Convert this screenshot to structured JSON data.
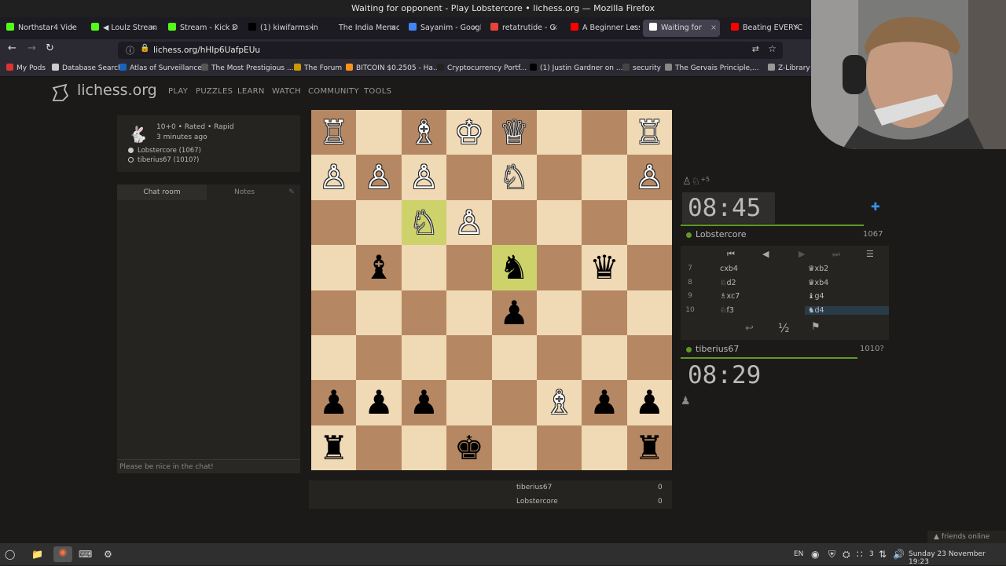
{
  "window": {
    "title": "Waiting for opponent - Play Lobstercore • lichess.org — Mozilla Firefox"
  },
  "tabs": [
    {
      "label": "Northstar4 Vide",
      "color": "#53fc18"
    },
    {
      "label": "◀ Loulz Strean",
      "color": "#53fc18"
    },
    {
      "label": "Stream - Kick D",
      "color": "#53fc18"
    },
    {
      "label": "(1) kiwifarms in",
      "color": "#000000"
    },
    {
      "label": "The India Menace |",
      "color": ""
    },
    {
      "label": "Sayanim - Googl",
      "color": "#4285f4"
    },
    {
      "label": "retatrutide - G",
      "color": "#ea4335"
    },
    {
      "label": "A Beginner Less",
      "color": "#ff0000"
    },
    {
      "label": "Waiting for",
      "color": "#ffffff"
    },
    {
      "label": "Beating EVERYC",
      "color": "#ff0000"
    }
  ],
  "nav": {
    "url": "lichess.org/hHlp6UafpEUu"
  },
  "bookmarks": [
    {
      "label": "My Pods",
      "color": "#d33"
    },
    {
      "label": "Database Search",
      "color": "#ccc"
    },
    {
      "label": "Atlas of Surveillance",
      "color": "#1565c0"
    },
    {
      "label": "The Most Prestigious ...",
      "color": "#555"
    },
    {
      "label": "The Forum",
      "color": "#c90"
    },
    {
      "label": "BITCOIN $0.2505 - Ha...",
      "color": "#f7931a"
    },
    {
      "label": "Cryptocurrency Portf...",
      "color": "#222"
    },
    {
      "label": "(1) Justin Gardner on ...",
      "color": "#000"
    },
    {
      "label": "security",
      "color": "#444"
    },
    {
      "label": "The Gervais Principle,...",
      "color": "#888"
    },
    {
      "label": "Z-Library - the",
      "color": "#999"
    }
  ],
  "site": {
    "logo": "lichess.org",
    "nav": [
      "PLAY",
      "PUZZLES",
      "LEARN",
      "WATCH",
      "COMMUNITY",
      "TOOLS"
    ]
  },
  "game": {
    "setup": "10+0 • Rated • Rapid",
    "time_ago": "3 minutes ago",
    "white_player": "Lobstercore (1067)",
    "black_player": "tiberius67 (1010?)"
  },
  "chat": {
    "tab_chat": "Chat room",
    "tab_notes": "Notes",
    "placeholder": "Please be nice in the chat!"
  },
  "board": {
    "orientation": "black",
    "light": "#f0d9b5",
    "dark": "#b58863",
    "last_move_color": "#ced26b",
    "last_move_squares": [
      "d4",
      "f3"
    ],
    "pieces": [
      {
        "sq": "h1",
        "p": "R",
        "c": "w"
      },
      {
        "sq": "f1",
        "p": "B",
        "c": "w"
      },
      {
        "sq": "e1",
        "p": "K",
        "c": "w"
      },
      {
        "sq": "d1",
        "p": "Q",
        "c": "w"
      },
      {
        "sq": "a1",
        "p": "R",
        "c": "w"
      },
      {
        "sq": "h2",
        "p": "P",
        "c": "w"
      },
      {
        "sq": "g2",
        "p": "P",
        "c": "w"
      },
      {
        "sq": "f2",
        "p": "P",
        "c": "w"
      },
      {
        "sq": "d2",
        "p": "N",
        "c": "w"
      },
      {
        "sq": "a2",
        "p": "P",
        "c": "w"
      },
      {
        "sq": "f3",
        "p": "N",
        "c": "w"
      },
      {
        "sq": "e3",
        "p": "P",
        "c": "w"
      },
      {
        "sq": "g4",
        "p": "B",
        "c": "b"
      },
      {
        "sq": "d4",
        "p": "N",
        "c": "b"
      },
      {
        "sq": "b4",
        "p": "Q",
        "c": "b"
      },
      {
        "sq": "d5",
        "p": "P",
        "c": "b"
      },
      {
        "sq": "h7",
        "p": "P",
        "c": "b"
      },
      {
        "sq": "g7",
        "p": "P",
        "c": "b"
      },
      {
        "sq": "f7",
        "p": "P",
        "c": "b"
      },
      {
        "sq": "c7",
        "p": "B",
        "c": "w"
      },
      {
        "sq": "b7",
        "p": "P",
        "c": "b"
      },
      {
        "sq": "a7",
        "p": "P",
        "c": "b"
      },
      {
        "sq": "h8",
        "p": "R",
        "c": "b"
      },
      {
        "sq": "e8",
        "p": "K",
        "c": "b"
      },
      {
        "sq": "a8",
        "p": "R",
        "c": "b"
      }
    ]
  },
  "top_player": {
    "name": "Lobstercore",
    "rating": "1067",
    "clock": "08:45",
    "material": "+5"
  },
  "bottom_player": {
    "name": "tiberius67",
    "rating": "1010?",
    "clock": "08:29"
  },
  "moves": [
    {
      "n": "7",
      "w": "cxb4",
      "b": "♛xb2"
    },
    {
      "n": "8",
      "w": "♘d2",
      "b": "♛xb4"
    },
    {
      "n": "9",
      "w": "♗xc7",
      "b": "♝g4"
    },
    {
      "n": "10",
      "w": "♘f3",
      "b": "♞d4"
    }
  ],
  "actions": {
    "draw": "½"
  },
  "scores": [
    {
      "name": "tiberius67",
      "value": "0"
    },
    {
      "name": "Lobstercore",
      "value": "0"
    }
  ],
  "friends": "friends online",
  "taskbar": {
    "lang": "EN",
    "num": "3",
    "datetime": "Sunday 23 November 19:23"
  }
}
